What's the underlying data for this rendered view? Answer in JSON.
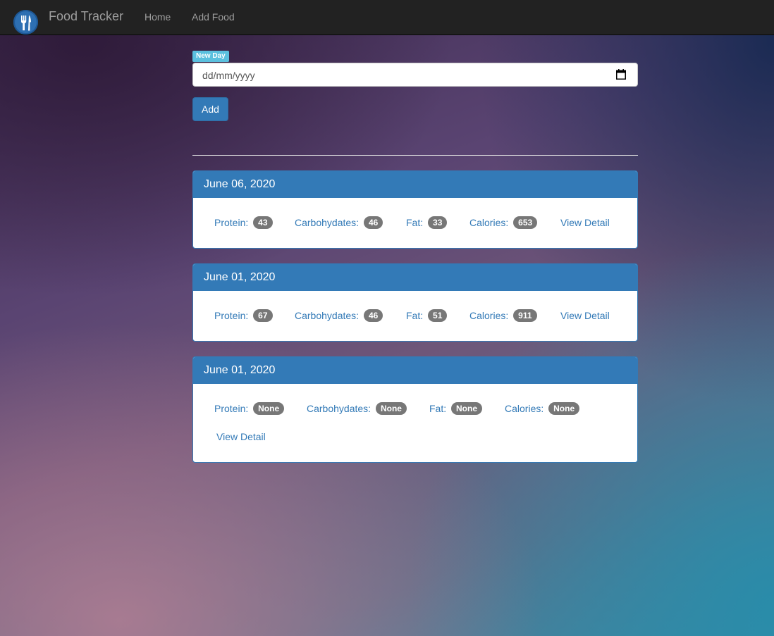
{
  "navbar": {
    "brand": "Food Tracker",
    "links": [
      "Home",
      "Add Food"
    ]
  },
  "form": {
    "label": "New Day",
    "date_placeholder": "dd/mm/yyyy",
    "add_button": "Add"
  },
  "days": [
    {
      "date": "June 06, 2020",
      "protein_label": "Protein:",
      "protein": "43",
      "carbs_label": "Carbohydates:",
      "carbs": "46",
      "fat_label": "Fat:",
      "fat": "33",
      "calories_label": "Calories:",
      "calories": "653",
      "detail_link": "View Detail"
    },
    {
      "date": "June 01, 2020",
      "protein_label": "Protein:",
      "protein": "67",
      "carbs_label": "Carbohydates:",
      "carbs": "46",
      "fat_label": "Fat:",
      "fat": "51",
      "calories_label": "Calories:",
      "calories": "911",
      "detail_link": "View Detail"
    },
    {
      "date": "June 01, 2020",
      "protein_label": "Protein:",
      "protein": "None",
      "carbs_label": "Carbohydates:",
      "carbs": "None",
      "fat_label": "Fat:",
      "fat": "None",
      "calories_label": "Calories:",
      "calories": "None",
      "detail_link": "View Detail"
    }
  ],
  "colors": {
    "navbar": "#222222",
    "primary": "#337ab7",
    "label_info": "#5bc0de",
    "badge": "#777777"
  },
  "icons": {
    "logo": "fork-knife-icon",
    "date_picker": "calendar-icon"
  }
}
